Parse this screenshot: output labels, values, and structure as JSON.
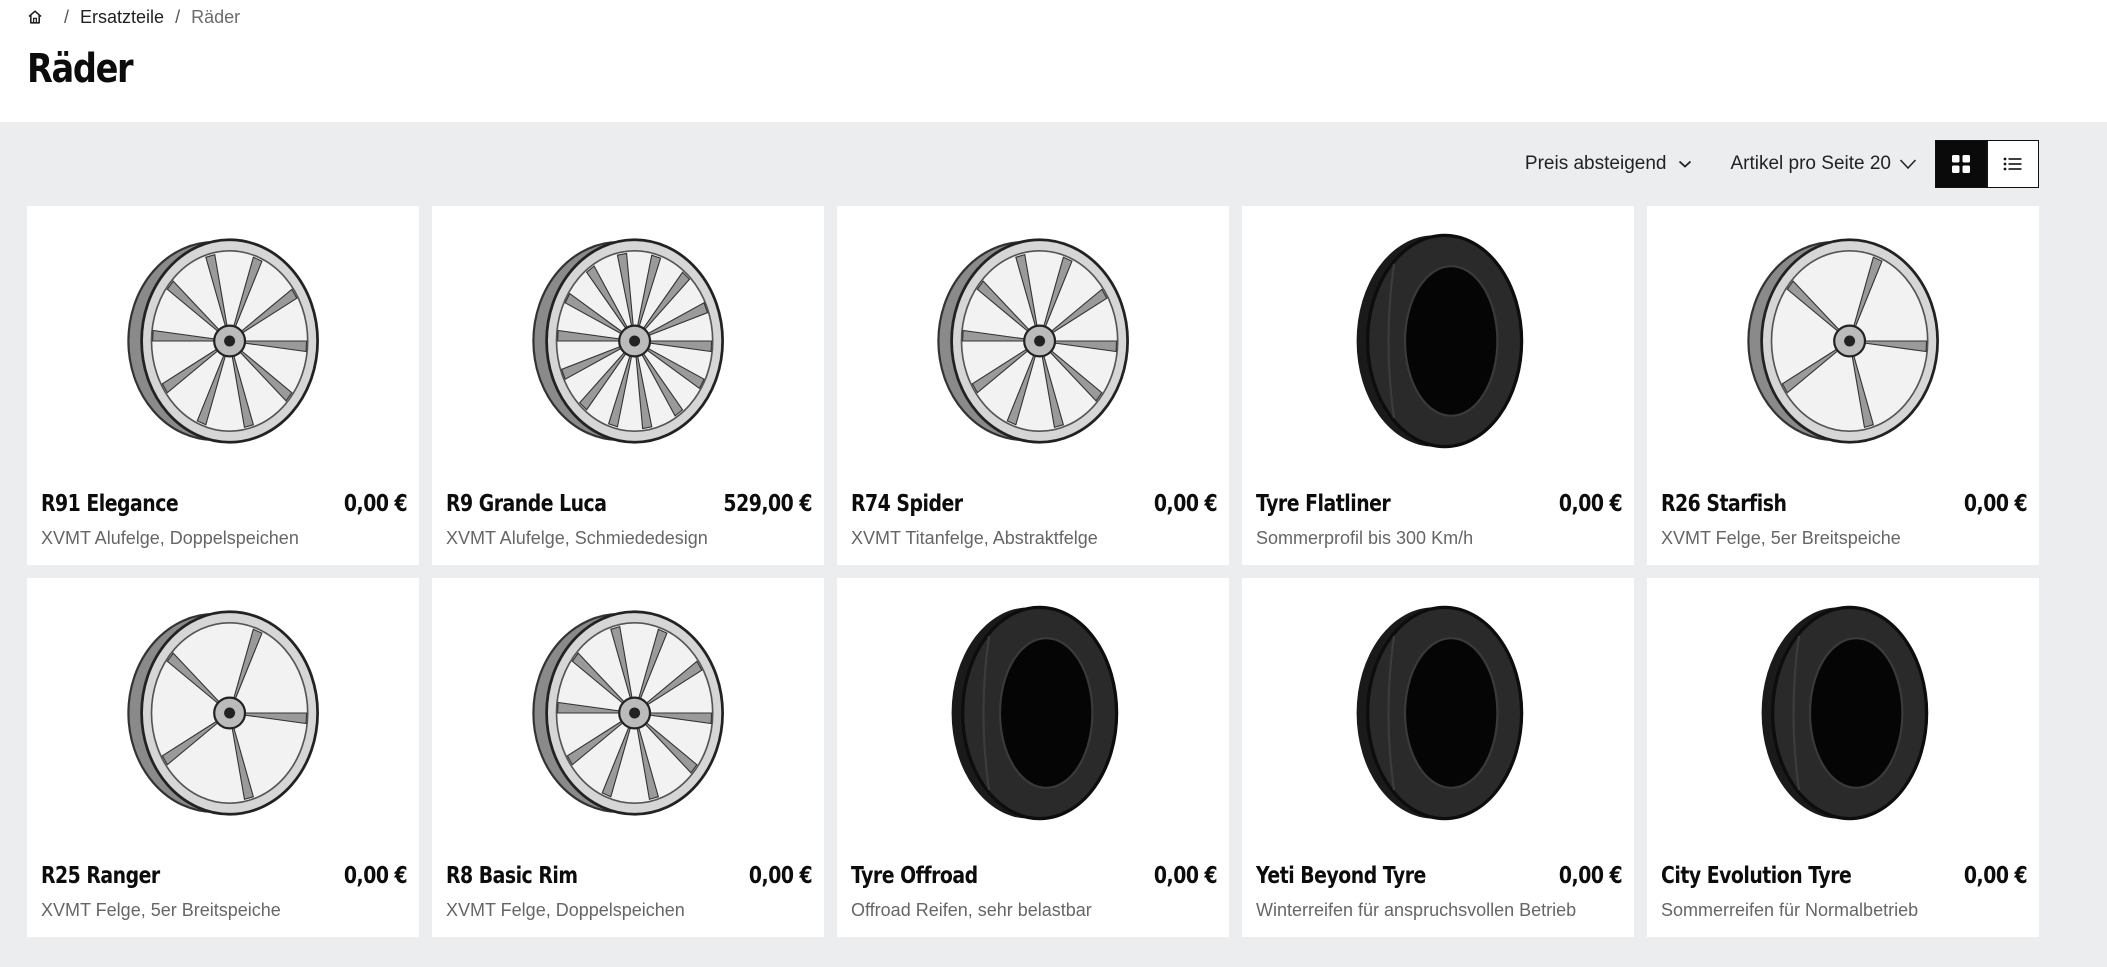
{
  "breadcrumb": {
    "home_icon": "home-icon",
    "items": [
      "Ersatzteile",
      "Räder"
    ],
    "separator": "/"
  },
  "page": {
    "title": "Räder"
  },
  "toolbar": {
    "sort_label": "Preis absteigend",
    "per_page_label": "Artikel pro Seite 20",
    "grid_view_icon": "grid-view-icon",
    "list_view_icon": "list-view-icon",
    "active_view": "grid"
  },
  "products": [
    {
      "name": "R91 Elegance",
      "price": "0,00 €",
      "description": "XVMT Alufelge, Doppelspeichen",
      "kind": "rim",
      "icon": "rim-image"
    },
    {
      "name": "R9 Grande Luca",
      "price": "529,00 €",
      "description": "XVMT Alufelge, Schmiededesign",
      "kind": "rim",
      "icon": "rim-image"
    },
    {
      "name": "R74 Spider",
      "price": "0,00 €",
      "description": "XVMT Titanfelge, Abstraktfelge",
      "kind": "rim",
      "icon": "rim-image"
    },
    {
      "name": "Tyre Flatliner",
      "price": "0,00 €",
      "description": "Sommerprofil bis 300 Km/h",
      "kind": "tyre",
      "icon": "tyre-image"
    },
    {
      "name": "R26 Starfish",
      "price": "0,00 €",
      "description": "XVMT Felge, 5er Breitspeiche",
      "kind": "rim",
      "icon": "rim-image"
    },
    {
      "name": "R25 Ranger",
      "price": "0,00 €",
      "description": "XVMT Felge, 5er Breitspeiche",
      "kind": "rim",
      "icon": "rim-image"
    },
    {
      "name": "R8 Basic Rim",
      "price": "0,00 €",
      "description": "XVMT Felge, Doppelspeichen",
      "kind": "rim",
      "icon": "rim-image"
    },
    {
      "name": "Tyre Offroad",
      "price": "0,00 €",
      "description": "Offroad Reifen, sehr belastbar",
      "kind": "tyre",
      "icon": "tyre-image"
    },
    {
      "name": "Yeti Beyond Tyre",
      "price": "0,00 €",
      "description": "Winterreifen für anspruchsvollen Betrieb",
      "kind": "tyre",
      "icon": "tyre-image"
    },
    {
      "name": "City Evolution Tyre",
      "price": "0,00 €",
      "description": "Sommerreifen für Normalbetrieb",
      "kind": "tyre",
      "icon": "tyre-image"
    }
  ],
  "colors": {
    "background": "#ecedee",
    "card": "#ffffff",
    "accent": "#0a0a0a",
    "muted_text": "#666666"
  }
}
